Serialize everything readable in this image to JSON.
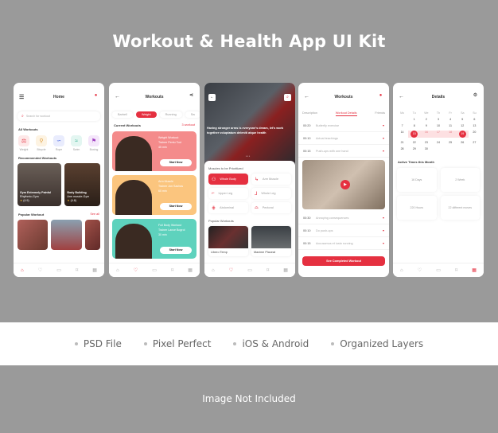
{
  "page": {
    "title": "Workout & Health App UI Kit",
    "features": [
      "PSD File",
      "Pixel Perfect",
      "iOS & Android",
      "Organized Layers"
    ],
    "footer_note": "Image Not Included",
    "accent": "#e53040"
  },
  "home": {
    "title": "Home",
    "search_placeholder": "Search for workout",
    "all_workouts_label": "All Workouts",
    "categories": [
      {
        "label": "Weight",
        "icon": "dumbbell-icon",
        "bg": "#fde8e8"
      },
      {
        "label": "Bicycle",
        "icon": "bicycle-icon",
        "bg": "#fdf3e2"
      },
      {
        "label": "Rope",
        "icon": "rope-icon",
        "bg": "#e9ecfd"
      },
      {
        "label": "Swim",
        "icon": "swim-icon",
        "bg": "#e3f6f1"
      },
      {
        "label": "Boxing",
        "icon": "boxing-icon",
        "bg": "#f4e6fa"
      }
    ],
    "recommended_label": "Recommended Workouts",
    "recommended": [
      {
        "name": "Gym Extremely Painful",
        "place": "Rhythmic-Gym",
        "rating": "(4.9)"
      },
      {
        "name": "Body Building",
        "place": "Arm muscle-Gym",
        "rating": "(4.8)"
      }
    ],
    "popular_label": "Popular Workout",
    "see_all": "See all"
  },
  "workouts": {
    "title": "Workouts",
    "filters": [
      "Barbell",
      "Weight",
      "Running",
      "Sw"
    ],
    "active_filter": "Weight",
    "current_label": "Current Workouts",
    "count_label": "3 workout",
    "cards": [
      {
        "title": "Weight Workout",
        "trainer": "Trainer Pentu Tool",
        "duration": "45 min",
        "button": "Start Now",
        "color": "#f48b8b"
      },
      {
        "title": "Arm Muscle",
        "trainer": "Trainer Jon Sachas",
        "duration": "60 min",
        "button": "Start Now",
        "color": "#fbc57e"
      },
      {
        "title": "Full Body Workout",
        "trainer": "Trainer Lance Bogrol",
        "duration": "30 min",
        "button": "Start Now",
        "color": "#5ed2bd"
      }
    ]
  },
  "muscles": {
    "hero_text": "Having stronger arms is everyone's dream, let's work together voluptatum deleniti atque health",
    "section_label": "Muscles to be Prioritized",
    "items": [
      {
        "label": "Whole Body",
        "icon": "whole-body-icon",
        "active": true
      },
      {
        "label": "Arm Muscle",
        "icon": "arm-icon",
        "active": false
      },
      {
        "label": "Upper Leg",
        "icon": "upper-leg-icon",
        "active": false
      },
      {
        "label": "Whole Leg",
        "icon": "leg-icon",
        "active": false
      },
      {
        "label": "Abdominal",
        "icon": "abs-icon",
        "active": false
      },
      {
        "label": "Pectoral",
        "icon": "chest-icon",
        "active": false
      }
    ],
    "popular_label": "Popular Workouts",
    "popular": [
      {
        "name": "Libero Temp"
      },
      {
        "name": "Maxime Placeat"
      }
    ]
  },
  "details_workouts": {
    "title": "Workouts",
    "tabs": [
      "Description",
      "Workout Details",
      "Friends"
    ],
    "active_tab": "Workout Details",
    "steps_top": [
      {
        "time": "00:20",
        "name": "Butterfly exercise"
      },
      {
        "time": "00:10",
        "name": "Actual teachings"
      },
      {
        "time": "00:15",
        "name": "Push-ups with one hand"
      }
    ],
    "steps_bottom": [
      {
        "time": "00:30",
        "name": "Annoying consequences"
      },
      {
        "time": "00:10",
        "name": "Do push-ups"
      },
      {
        "time": "00:15",
        "name": "Accusamus et iusto running"
      }
    ],
    "button": "See Completed Workout"
  },
  "details": {
    "title": "Details",
    "weekdays": [
      "Mo",
      "Tu",
      "We",
      "Th",
      "Fr",
      "Sa",
      "Su"
    ],
    "leading_blanks": 1,
    "days": 30,
    "range_start": 15,
    "range_end": 19,
    "active_label": "Active Times this Month",
    "stats": [
      "16 Days",
      "2 Week",
      "220 Hours",
      "22 different moves"
    ]
  }
}
